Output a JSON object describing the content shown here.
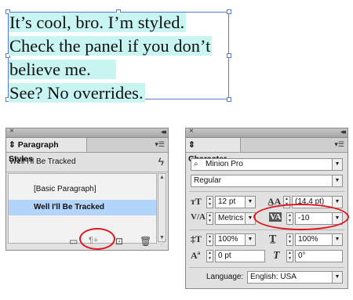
{
  "text_frame": {
    "lines": [
      "It’s cool, bro. I’m styled.",
      "Check the panel if you don’t",
      "believe me.",
      "See? No overrides."
    ]
  },
  "paragraph_panel": {
    "tab_label": "Paragraph Styles",
    "current_style": "Well I'll Be Tracked",
    "items": [
      "[Basic Paragraph]",
      "Well I'll Be Tracked"
    ],
    "selected_index": 1
  },
  "character_panel": {
    "tab_label": "Character",
    "font_family": "Minion Pro",
    "font_style": "Regular",
    "font_size": "12 pt",
    "leading": "(14.4 pt)",
    "kerning": "Metrics",
    "tracking": "-10",
    "vertical_scale": "100%",
    "horizontal_scale": "100%",
    "baseline_shift": "0 pt",
    "skew": "0°",
    "language_label": "Language:",
    "language": "English: USA"
  },
  "colors": {
    "highlight": "#c8f5f2",
    "selection": "#b3d4fb",
    "annotation_red": "#e0141c",
    "frame_blue": "#5a7bd6"
  },
  "icons": [
    "close-icon",
    "collapse-icon",
    "panel-menu-icon",
    "lightning-icon",
    "new-group-icon",
    "clear-overrides-icon",
    "new-style-icon",
    "trash-icon",
    "resize-icon",
    "font-size-icon",
    "leading-icon",
    "kerning-icon",
    "tracking-icon",
    "vertical-scale-icon",
    "horizontal-scale-icon",
    "baseline-shift-icon",
    "skew-icon"
  ]
}
